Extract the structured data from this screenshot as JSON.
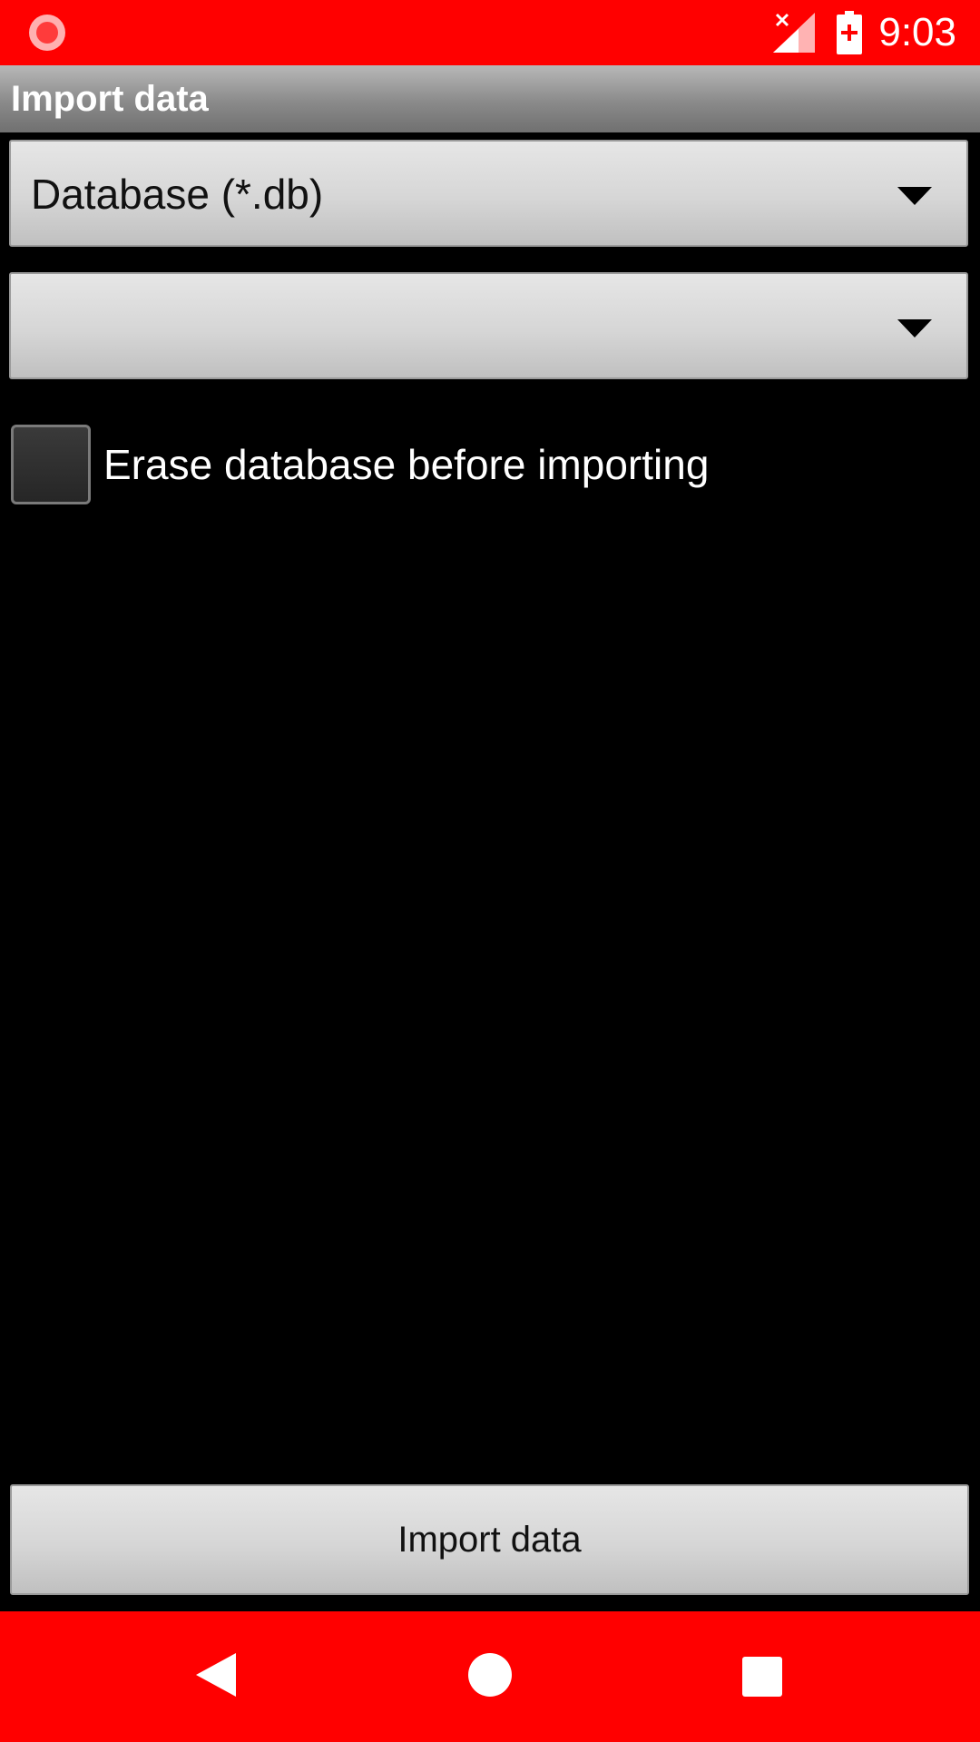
{
  "status_bar": {
    "time": "9:03",
    "color": "#ff0000",
    "icons": [
      "screen-record-icon",
      "signal-no-service-icon",
      "battery-charging-icon"
    ]
  },
  "title_bar": {
    "title": "Import data"
  },
  "form": {
    "file_type_spinner": {
      "selected": "Database (*.db)"
    },
    "file_spinner": {
      "selected": ""
    },
    "erase_checkbox": {
      "label": "Erase database before importing",
      "checked": false
    }
  },
  "import_button": {
    "label": "Import data"
  },
  "nav_bar": {
    "color": "#ff0000",
    "icons": [
      "back-icon",
      "home-icon",
      "recents-icon"
    ]
  }
}
